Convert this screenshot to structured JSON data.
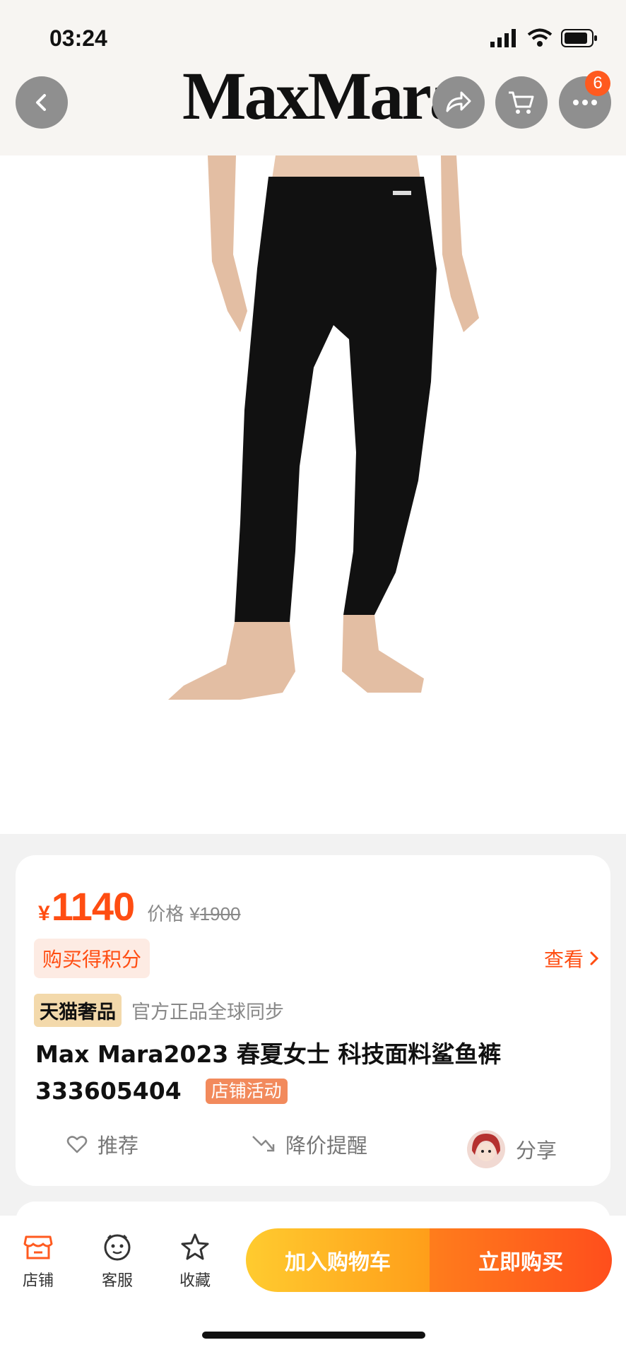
{
  "status": {
    "time": "03:24"
  },
  "header": {
    "brand": "MaxMara",
    "cart_badge": "6"
  },
  "product": {
    "price_currency": "¥",
    "price": "1140",
    "orig_label": "价格",
    "orig_currency": "¥",
    "orig_price": "1900",
    "points_tag": "购买得积分",
    "view_link": "查看",
    "lux_tag": "天猫奢品",
    "lux_desc": "官方正品全球同步",
    "title_line1": "Max Mara2023 春夏女士 科技面料鲨鱼裤",
    "title_line2": "333605404",
    "store_tag": "店铺活动"
  },
  "actions": {
    "recommend": "推荐",
    "price_alert": "降价提醒",
    "share": "分享"
  },
  "bottom": {
    "store": "店铺",
    "service": "客服",
    "favorite": "收藏",
    "add_to_cart": "加入购物车",
    "buy_now": "立即购买"
  },
  "colors": {
    "accent": "#ff4d12",
    "cart_gradient_start": "#ffcb2f",
    "buy_gradient_end": "#ff4e1c",
    "lux_tag_bg": "#f3d9ab"
  },
  "icons": [
    "back-icon",
    "share-icon",
    "cart-icon",
    "more-icon",
    "heart-icon",
    "price-drop-icon",
    "store-icon",
    "service-icon",
    "star-icon"
  ]
}
